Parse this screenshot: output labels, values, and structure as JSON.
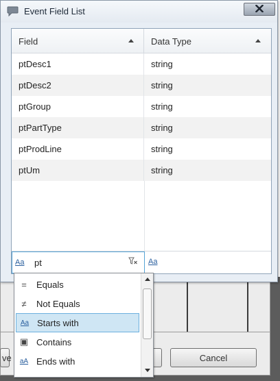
{
  "dialog": {
    "title": "Event Field List",
    "close_label": "X"
  },
  "grid": {
    "columns": [
      {
        "label": "Field",
        "sort": "ascending"
      },
      {
        "label": "Data Type",
        "sort": "ascending"
      }
    ],
    "rows": [
      {
        "field": "ptDesc1",
        "type": "string"
      },
      {
        "field": "ptDesc2",
        "type": "string"
      },
      {
        "field": "ptGroup",
        "type": "string"
      },
      {
        "field": "ptPartType",
        "type": "string"
      },
      {
        "field": "ptProdLine",
        "type": "string"
      },
      {
        "field": "ptUm",
        "type": "string"
      }
    ],
    "filter": {
      "field_operator_icon": "Aa",
      "field_value": "pt",
      "clear_icon": "filter-clear-icon",
      "type_operator_icon": "Aa"
    }
  },
  "dropdown": {
    "items": [
      {
        "icon": "equals-icon",
        "glyph": "=",
        "label": "Equals",
        "selected": false
      },
      {
        "icon": "not-equals-icon",
        "glyph": "≠",
        "label": "Not Equals",
        "selected": false
      },
      {
        "icon": "starts-with-icon",
        "glyph": "Aa",
        "label": "Starts with",
        "selected": true
      },
      {
        "icon": "contains-icon",
        "glyph": "▣",
        "label": "Contains",
        "selected": false
      },
      {
        "icon": "ends-with-icon",
        "glyph": "aA",
        "label": "Ends with",
        "selected": false
      }
    ]
  },
  "background": {
    "ok_label": "ve",
    "cancel_label": "Cancel"
  },
  "colors": {
    "accent": "#56a3d6",
    "selection": "#cfe6f4",
    "alt_row": "#f2f2f2"
  }
}
